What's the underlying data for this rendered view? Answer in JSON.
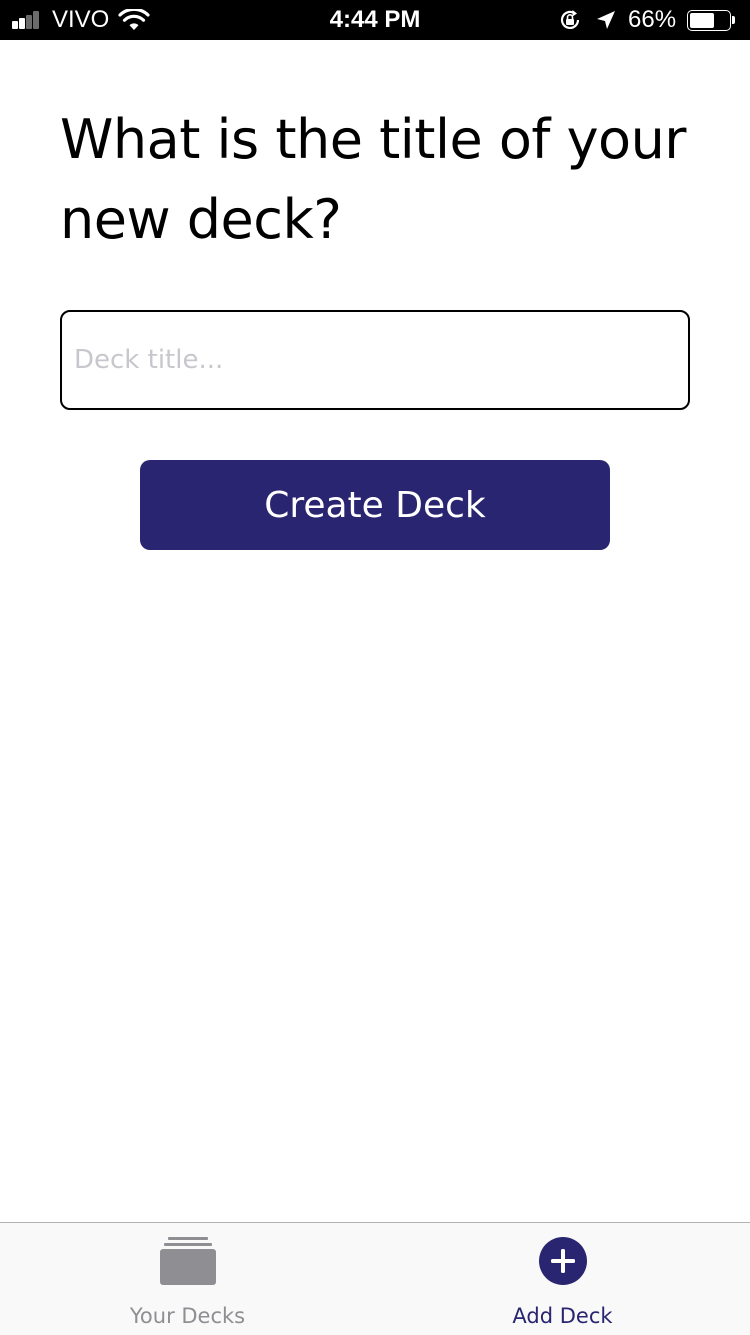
{
  "status_bar": {
    "carrier": "VIVO",
    "time": "4:44 PM",
    "battery_percent_label": "66%",
    "battery_level": 0.66
  },
  "main": {
    "question": "What is the title of your new deck?",
    "deck_title_input": {
      "value": "",
      "placeholder": "Deck title..."
    },
    "create_button_label": "Create Deck"
  },
  "tab_bar": {
    "tabs": [
      {
        "label": "Your Decks",
        "icon": "decks-stack-icon",
        "active": false
      },
      {
        "label": "Add Deck",
        "icon": "add-circle-icon",
        "active": true
      }
    ]
  },
  "colors": {
    "accent": "#2a2570",
    "inactive_tab": "#8e8e93",
    "input_border": "#000000",
    "placeholder": "#c7c7cd"
  }
}
